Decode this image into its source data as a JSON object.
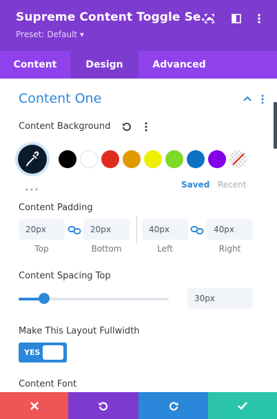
{
  "header": {
    "title": "Supreme Content Toggle Se...",
    "preset": "Preset: Default ▾",
    "icons": [
      "screenshot-icon",
      "sidebar-icon",
      "more-vertical-icon"
    ]
  },
  "tabs": [
    {
      "label": "Content",
      "active": false
    },
    {
      "label": "Design",
      "active": true
    },
    {
      "label": "Advanced",
      "active": false
    }
  ],
  "section": {
    "title": "Content One",
    "icons": [
      "chevron-up-icon",
      "more-vertical-icon"
    ]
  },
  "content_background": {
    "label": "Content Background",
    "icons": [
      "reset-icon",
      "more-vertical-icon",
      "eyedropper-icon",
      "ellipsis-icon"
    ],
    "swatches": [
      {
        "name": "black",
        "color": "#000000"
      },
      {
        "name": "white",
        "color": "#ffffff"
      },
      {
        "name": "red",
        "color": "#e02b20"
      },
      {
        "name": "orange",
        "color": "#e09900"
      },
      {
        "name": "yellow",
        "color": "#edf000"
      },
      {
        "name": "green",
        "color": "#7cda24"
      },
      {
        "name": "blue",
        "color": "#0c71c3"
      },
      {
        "name": "purple",
        "color": "#8300e9"
      },
      {
        "name": "none",
        "color": "transparent"
      }
    ],
    "saved_label": "Saved",
    "recent_label": "Recent"
  },
  "content_padding": {
    "label": "Content Padding",
    "top": {
      "value": "20px",
      "label": "Top"
    },
    "bottom": {
      "value": "20px",
      "label": "Bottom"
    },
    "left": {
      "value": "40px",
      "label": "Left"
    },
    "right": {
      "value": "40px",
      "label": "Right"
    }
  },
  "content_spacing_top": {
    "label": "Content Spacing Top",
    "value": "30px",
    "slider_fraction": 0.17
  },
  "fullwidth": {
    "label": "Make This Layout Fullwidth",
    "toggle_label": "YES"
  },
  "content_font": {
    "label": "Content Font"
  },
  "bottom_bar": {
    "buttons": [
      {
        "name": "discard",
        "color": "#ef5555"
      },
      {
        "name": "undo",
        "color": "#7e3bd0"
      },
      {
        "name": "redo",
        "color": "#2b87da"
      },
      {
        "name": "save",
        "color": "#29c4a9"
      }
    ]
  },
  "colors": {
    "header": "#7e3bd0",
    "tabs": "#8f42ec",
    "accent": "#2b87da"
  }
}
